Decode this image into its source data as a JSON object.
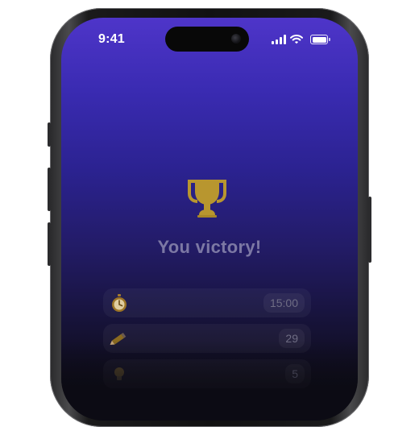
{
  "status_bar": {
    "time": "9:41",
    "icons": [
      "signal-icon",
      "wifi-icon",
      "battery-icon"
    ]
  },
  "result": {
    "icon": "trophy-icon",
    "title": "You victory!"
  },
  "stats": [
    {
      "icon": "stopwatch-icon",
      "value": "15:00"
    },
    {
      "icon": "pencil-icon",
      "value": "29"
    },
    {
      "icon": "lightbulb-icon",
      "value": "5"
    }
  ],
  "colors": {
    "background_top": "#4e35c9",
    "background_bottom": "#0c0b14",
    "trophy": "#b8962f",
    "title": "#7c78a4"
  }
}
